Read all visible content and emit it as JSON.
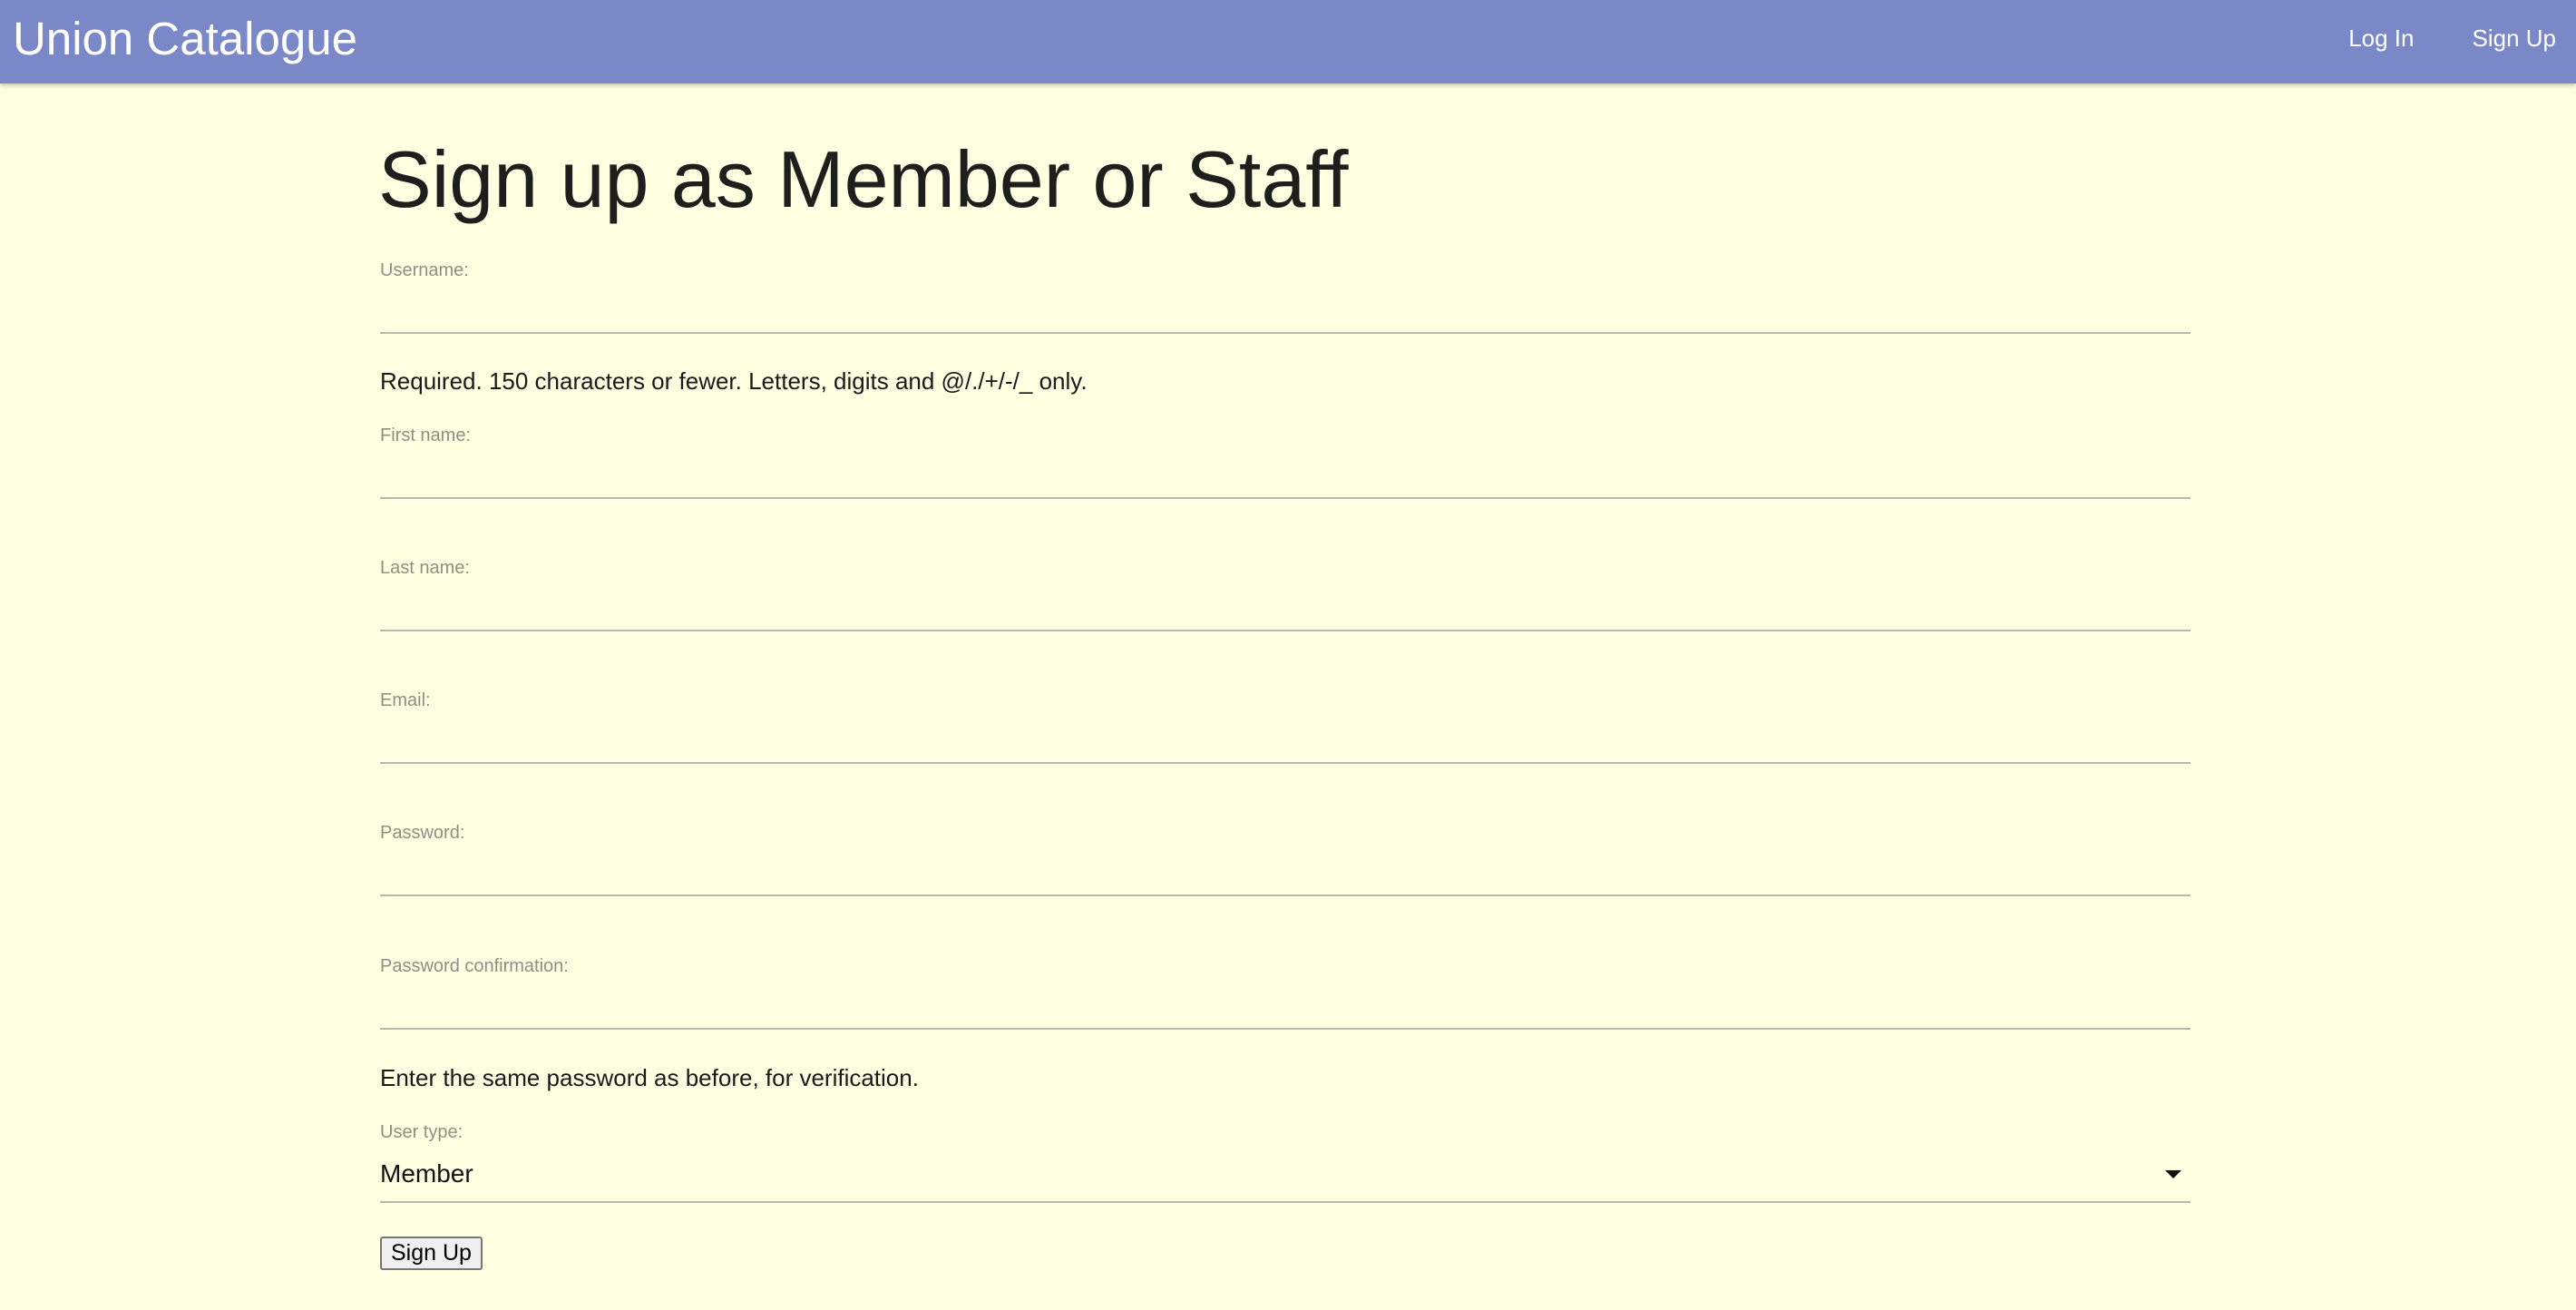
{
  "navbar": {
    "brand": "Union Catalogue",
    "login_label": "Log In",
    "signup_label": "Sign Up"
  },
  "page": {
    "title": "Sign up as Member or Staff"
  },
  "form": {
    "username": {
      "label": "Username:",
      "value": "",
      "help": "Required. 150 characters or fewer. Letters, digits and @/./+/-/_ only."
    },
    "first_name": {
      "label": "First name:",
      "value": ""
    },
    "last_name": {
      "label": "Last name:",
      "value": ""
    },
    "email": {
      "label": "Email:",
      "value": ""
    },
    "password": {
      "label": "Password:",
      "value": ""
    },
    "password_confirmation": {
      "label": "Password confirmation:",
      "value": "",
      "help": "Enter the same password as before, for verification."
    },
    "user_type": {
      "label": "User type:",
      "selected": "Member"
    },
    "submit_label": "Sign Up"
  },
  "icons": {
    "select_arrow": "chevron-down-icon"
  },
  "colors": {
    "navbar_bg": "#7b88c8",
    "page_bg": "#ffffe2",
    "field_border": "#b8b8ad",
    "label": "#8f8f86"
  }
}
